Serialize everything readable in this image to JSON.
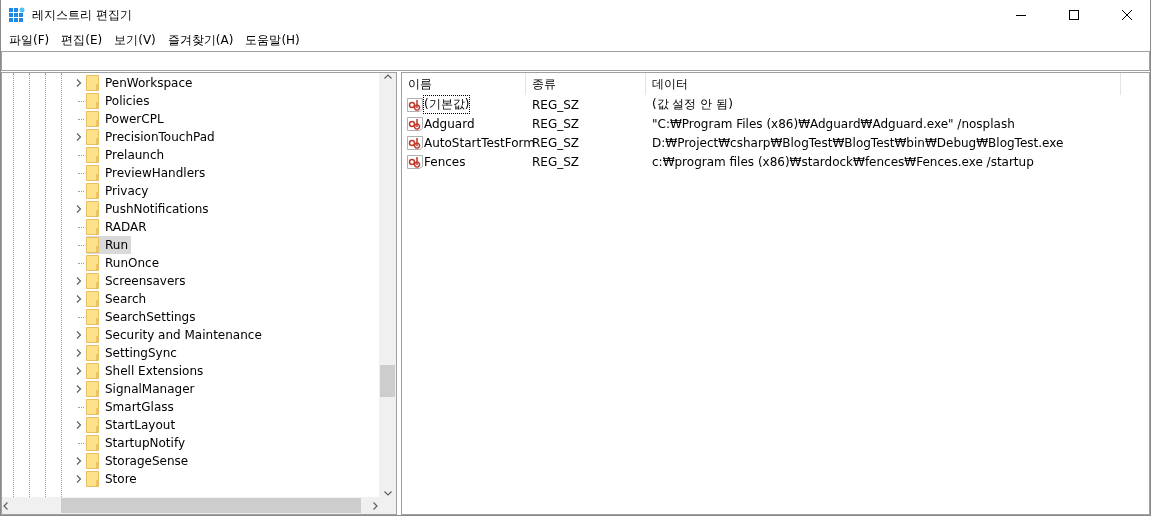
{
  "window": {
    "title": "레지스트리 편집기"
  },
  "menu": [
    "파일(F)",
    "편집(E)",
    "보기(V)",
    "즐겨찾기(A)",
    "도움말(H)"
  ],
  "tree": [
    {
      "label": "PenWorkspace",
      "expandable": true,
      "selected": false
    },
    {
      "label": "Policies",
      "expandable": false,
      "selected": false
    },
    {
      "label": "PowerCPL",
      "expandable": false,
      "selected": false
    },
    {
      "label": "PrecisionTouchPad",
      "expandable": true,
      "selected": false
    },
    {
      "label": "Prelaunch",
      "expandable": false,
      "selected": false
    },
    {
      "label": "PreviewHandlers",
      "expandable": false,
      "selected": false
    },
    {
      "label": "Privacy",
      "expandable": false,
      "selected": false
    },
    {
      "label": "PushNotifications",
      "expandable": true,
      "selected": false
    },
    {
      "label": "RADAR",
      "expandable": false,
      "selected": false
    },
    {
      "label": "Run",
      "expandable": false,
      "selected": true
    },
    {
      "label": "RunOnce",
      "expandable": false,
      "selected": false
    },
    {
      "label": "Screensavers",
      "expandable": true,
      "selected": false
    },
    {
      "label": "Search",
      "expandable": true,
      "selected": false
    },
    {
      "label": "SearchSettings",
      "expandable": false,
      "selected": false
    },
    {
      "label": "Security and Maintenance",
      "expandable": true,
      "selected": false
    },
    {
      "label": "SettingSync",
      "expandable": true,
      "selected": false
    },
    {
      "label": "Shell Extensions",
      "expandable": true,
      "selected": false
    },
    {
      "label": "SignalManager",
      "expandable": true,
      "selected": false
    },
    {
      "label": "SmartGlass",
      "expandable": false,
      "selected": false
    },
    {
      "label": "StartLayout",
      "expandable": true,
      "selected": false
    },
    {
      "label": "StartupNotify",
      "expandable": false,
      "selected": false
    },
    {
      "label": "StorageSense",
      "expandable": true,
      "selected": false
    },
    {
      "label": "Store",
      "expandable": true,
      "selected": false
    }
  ],
  "table": {
    "columns": [
      "이름",
      "종류",
      "데이터"
    ],
    "rows": [
      {
        "name": "(기본값)",
        "type": "REG_SZ",
        "data": "(값 설정 안 됨)",
        "focused": true
      },
      {
        "name": "Adguard",
        "type": "REG_SZ",
        "data": "\"C:₩Program Files (x86)₩Adguard₩Adguard.exe\" /nosplash",
        "focused": false
      },
      {
        "name": "AutoStartTestForm",
        "type": "REG_SZ",
        "data": "D:₩Project₩csharp₩BlogTest₩BlogTest₩bin₩Debug₩BlogTest.exe",
        "focused": false
      },
      {
        "name": "Fences",
        "type": "REG_SZ",
        "data": "c:₩program files (x86)₩stardock₩fences₩Fences.exe /startup",
        "focused": false
      }
    ]
  }
}
